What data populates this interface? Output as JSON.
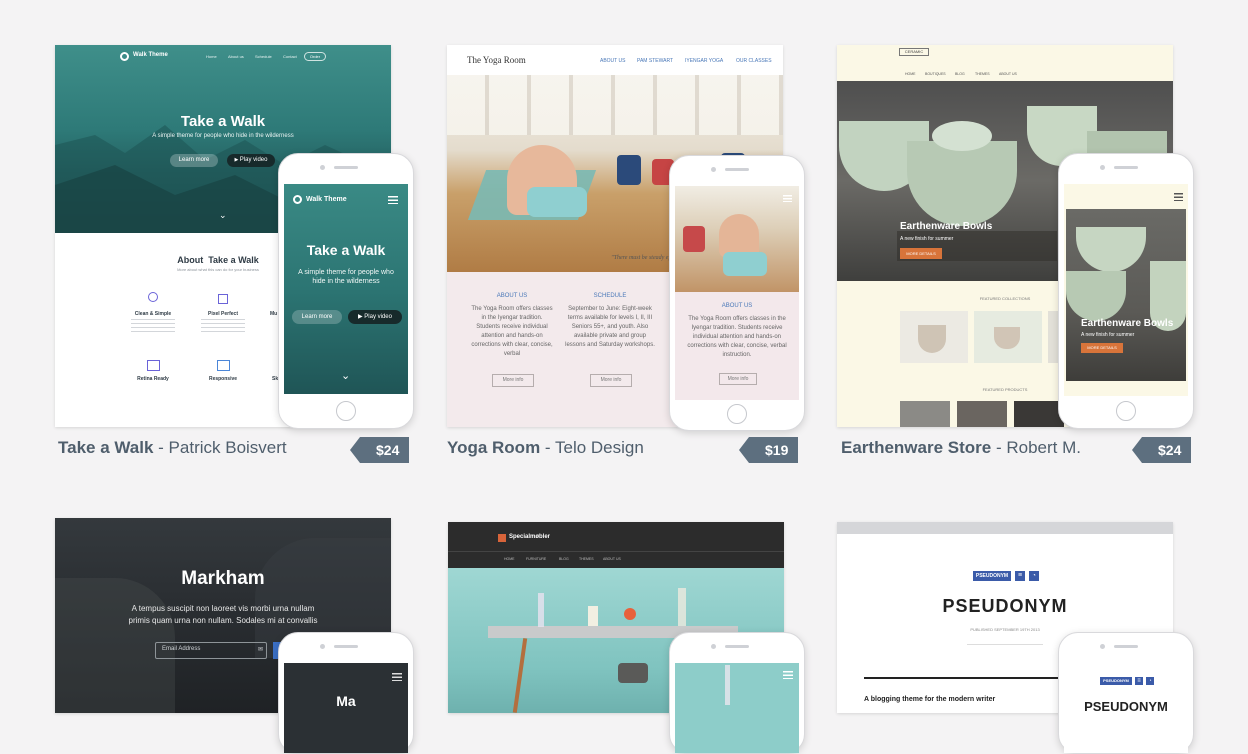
{
  "cards": [
    {
      "title": "Take a Walk",
      "author": "Patrick Boisvert",
      "price": "$24",
      "site": {
        "brand": "Walk Theme",
        "nav": [
          "Home",
          "About us",
          "Schedule",
          "Contact"
        ],
        "nav_button": "Order",
        "hero_title": "Take a Walk",
        "hero_subtitle": "A simple theme for people who hide in the wilderness",
        "btn_learn": "Learn more",
        "btn_play": "Play video",
        "about_title": "About  Take a Walk",
        "about_sub": "More about what this can do for your business",
        "features": [
          "Clean & Simple",
          "Pixel Perfect",
          "Mu",
          "Retina Ready",
          "Responsive",
          "Sk"
        ],
        "mobile_hero_title": "Take a Walk",
        "mobile_hero_sub": "A simple theme for people who hide in the wilderness"
      }
    },
    {
      "title": "Yoga Room",
      "author": "Telo Design",
      "price": "$19",
      "site": {
        "brand": "The Yoga Room",
        "nav": [
          "ABOUT US",
          "PAM STEWART",
          "IYENGAR YOGA",
          "OUR CLASSES"
        ],
        "quote": "\"There must be steady effort.\"",
        "col1_title": "ABOUT US",
        "col1_text": "The Yoga Room offers classes in the Iyengar tradition. Students receive individual attention and hands-on corrections with clear, concise, verbal",
        "col2_title": "SCHEDULE",
        "col2_text": "September to June: Eight-week terms available for levels I, II, III Seniors 55+, and youth. Also available private and group lessons and Saturday workshops.",
        "more": "More info",
        "mobile_title": "ABOUT US",
        "mobile_text": "The Yoga Room offers classes in the Iyengar tradition. Students receive individual attention and hands-on corrections with clear, concise, verbal instruction."
      }
    },
    {
      "title": "Earthenware Store",
      "author": "Robert M.",
      "price": "$24",
      "site": {
        "logo": "CERAMIC",
        "nav": [
          "HOME",
          "BOUTIQUES",
          "BLOG",
          "THEMES",
          "ABOUT US"
        ],
        "hero_title": "Earthenware Bowls",
        "hero_sub": "A new finish for summer",
        "hero_btn": "MORE DETAILS",
        "featured_collections": "FEATURED COLLECTIONS",
        "featured_products": "FEATURED PRODUCTS"
      }
    },
    {
      "site": {
        "hero_title": "Markham",
        "hero_text": "A tempus suscipit non laoreet vis morbi urna nullam primis quam urna non nullam. Sodales mi at convallis nullam sit vivamus vel Consectetur.",
        "email_placeholder": "Email Address",
        "mobile_title": "Ma"
      }
    },
    {
      "site": {
        "brand": "Specialmøbler",
        "nav": [
          "HOME",
          "FURNITURE",
          "BLOG",
          "THEMES",
          "ABOUT US"
        ]
      }
    },
    {
      "site": {
        "badge": "PSEUDONYM",
        "title": "PSEUDONYM",
        "date": "PUBLISHED SEPTEMBER 19TH 2013",
        "tagline": "A blogging theme for the modern writer",
        "mobile_badge": "PSEUDONYM",
        "mobile_title": "PSEUDONYM"
      }
    }
  ],
  "colors": {
    "page_bg": "#f4f3f4",
    "price_tag": "#5d6f7f",
    "meta_text": "#4f5e6c",
    "walk_teal": "#2d7b7a",
    "ceramic_orange": "#d8743a",
    "pseudonym_blue": "#3b5ba9"
  }
}
